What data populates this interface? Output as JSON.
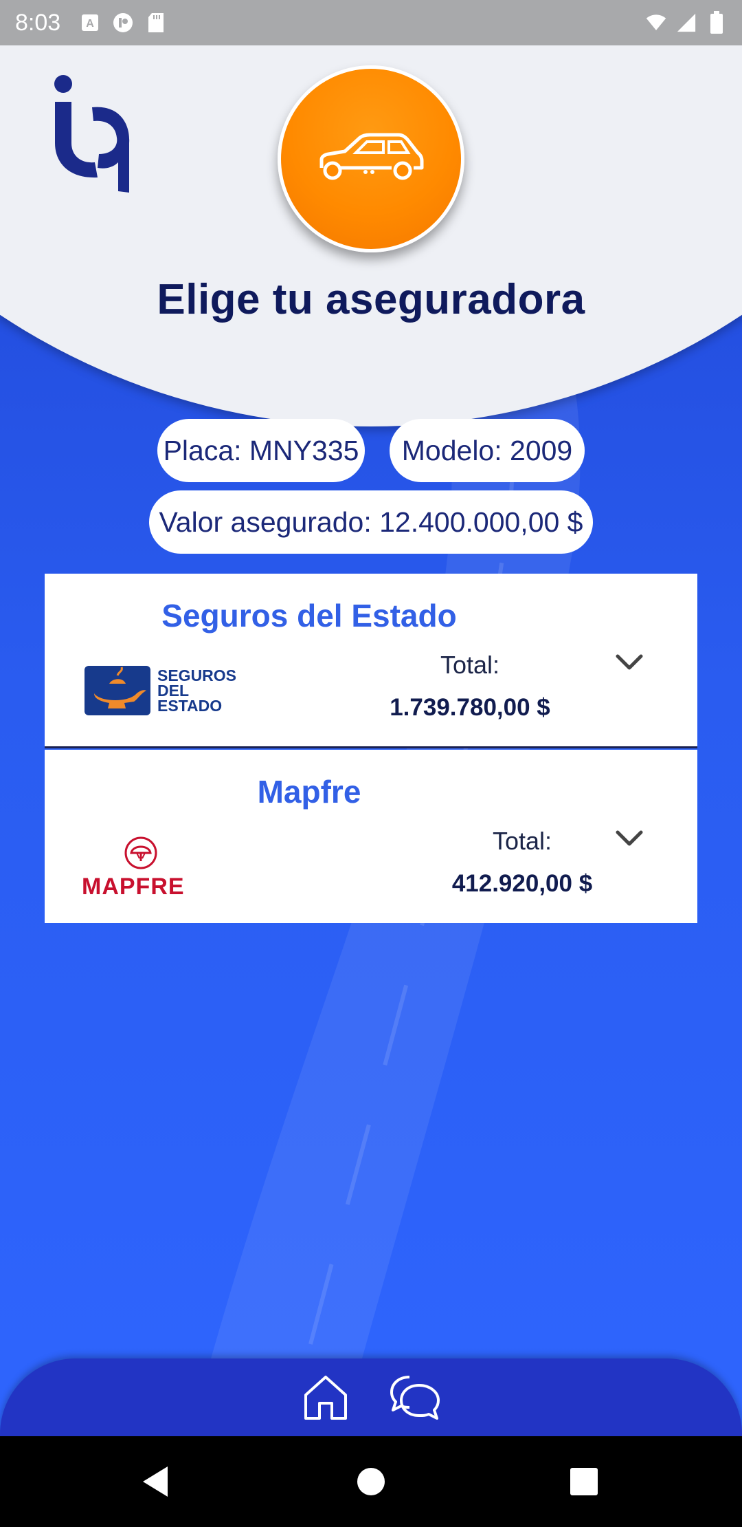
{
  "status_bar": {
    "time": "8:03",
    "left_icons": [
      "a-icon",
      "app-icon",
      "sd-card-icon"
    ],
    "right_icons": [
      "wifi-icon",
      "signal-icon",
      "battery-icon"
    ]
  },
  "header": {
    "logo": "iq-logo",
    "vehicle_icon": "car-icon",
    "title": "Elige tu aseguradora"
  },
  "vehicle_info": {
    "placa": "Placa: MNY335",
    "modelo": "Modelo: 2009",
    "valor_asegurado": "Valor asegurado: 12.400.000,00 $"
  },
  "insurers": [
    {
      "name": "Seguros del Estado",
      "logo_text": [
        "SEGUROS",
        "DEL",
        "ESTADO"
      ],
      "total_label": "Total:",
      "total_value": "1.739.780,00 $"
    },
    {
      "name": "Mapfre",
      "logo_text": "MAPFRE",
      "total_label": "Total:",
      "total_value": "412.920,00 $"
    }
  ],
  "bottom_nav": {
    "items": [
      "home-icon",
      "chat-icon"
    ]
  },
  "colors": {
    "accent": "#ff8a00",
    "primary_blue": "#2a5cf0",
    "title_navy": "#0f1a5c",
    "insurer_name_blue": "#3260e6",
    "mapfre_red": "#c8102e"
  }
}
